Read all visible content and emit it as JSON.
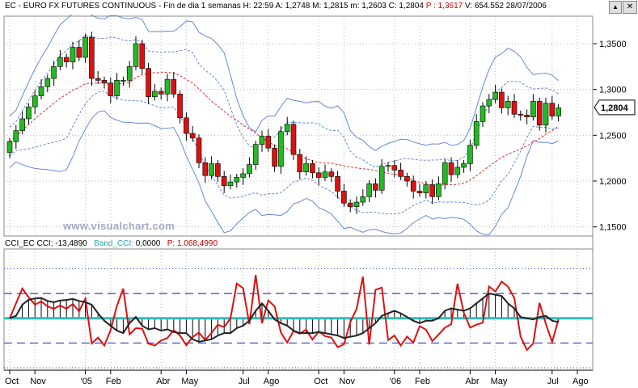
{
  "window": {
    "title_prefix": "EC - EURO FX FUTURES CONTINUOUS - Fin de dia 1 semanas H: 22:59 A: 1,2748 M: 1,2815 m: 1,2603 C: 1,2804",
    "title_p": "P : 1,3617",
    "title_suffix": "V: 654.552 28/07/2006",
    "close_glyph": "✕",
    "scroll_glyph": "▲"
  },
  "watermark": "www.visualchart.com",
  "colors": {
    "up": "#22bb22",
    "down": "#dd1111",
    "band": "#6688dd",
    "ma": "#dd3333",
    "cci": "#222222",
    "cci_signal": "#dd1111",
    "band_cci": "#33bbbb",
    "dash": "#3344bb"
  },
  "chart_data": [
    {
      "type": "candlestick",
      "title": "EC - EURO FX FUTURES CONTINUOUS",
      "ylim": [
        1.14,
        1.38
      ],
      "yticks": [
        "1,3500",
        "1,3000",
        "1,2500",
        "1,2000",
        "1,1500"
      ],
      "ytick_values": [
        1.35,
        1.3,
        1.25,
        1.2,
        1.15
      ],
      "last_close_label": "1,2804",
      "last_close": 1.2804,
      "close": [
        1.243,
        1.255,
        1.268,
        1.281,
        1.293,
        1.303,
        1.312,
        1.325,
        1.335,
        1.33,
        1.346,
        1.335,
        1.357,
        1.312,
        1.31,
        1.307,
        1.293,
        1.31,
        1.31,
        1.325,
        1.35,
        1.323,
        1.292,
        1.298,
        1.295,
        1.311,
        1.295,
        1.269,
        1.252,
        1.247,
        1.22,
        1.206,
        1.219,
        1.205,
        1.195,
        1.199,
        1.204,
        1.208,
        1.218,
        1.24,
        1.249,
        1.236,
        1.216,
        1.254,
        1.262,
        1.229,
        1.21,
        1.219,
        1.209,
        1.204,
        1.21,
        1.205,
        1.189,
        1.176,
        1.172,
        1.177,
        1.183,
        1.197,
        1.19,
        1.216,
        1.217,
        1.212,
        1.205,
        1.2,
        1.189,
        1.187,
        1.196,
        1.183,
        1.197,
        1.22,
        1.207,
        1.215,
        1.219,
        1.239,
        1.265,
        1.282,
        1.289,
        1.297,
        1.28,
        1.287,
        1.273,
        1.272,
        1.27,
        1.287,
        1.261,
        1.285,
        1.271,
        1.28
      ]
    },
    {
      "type": "line",
      "legend_label": "CCI_EC",
      "cci_label": "CCI:",
      "cci_value": "-13,4890",
      "band_label": "Band_CCI:",
      "band_value": "0,0000",
      "p_label": "P:",
      "p_value": "1.068,4990",
      "cci": [
        0,
        10,
        55,
        75,
        80,
        82,
        70,
        65,
        72,
        74,
        78,
        70,
        65,
        55,
        20,
        -10,
        -30,
        -50,
        -60,
        -20,
        5,
        -30,
        -45,
        -40,
        -50,
        -45,
        -55,
        -60,
        -60,
        -85,
        -95,
        -90,
        -85,
        -70,
        -60,
        -60,
        -40,
        -30,
        -10,
        30,
        60,
        30,
        -5,
        -20,
        -30,
        -50,
        -60,
        -60,
        -60,
        -55,
        -60,
        -65,
        -70,
        -80,
        -75,
        -70,
        -60,
        -40,
        -20,
        10,
        20,
        30,
        20,
        5,
        -10,
        -20,
        -10,
        -10,
        0,
        30,
        40,
        35,
        30,
        40,
        60,
        80,
        100,
        95,
        90,
        60,
        40,
        5,
        0,
        -5,
        5,
        10,
        -10,
        -15
      ],
      "cci_signal": [
        0,
        60,
        120,
        85,
        55,
        68,
        48,
        38,
        52,
        38,
        58,
        28,
        80,
        -102,
        -78,
        -110,
        -48,
        50,
        120,
        -65,
        -40,
        -42,
        -103,
        -110,
        -90,
        -80,
        -48,
        -70,
        -109,
        -76,
        -58,
        -88,
        -59,
        -26,
        -36,
        0,
        140,
        122,
        -24,
        175,
        -20,
        72,
        48,
        -58,
        -98,
        -52,
        -62,
        -46,
        -86,
        -54,
        -72,
        -78,
        -117,
        -105,
        -16,
        38,
        168,
        -106,
        115,
        124,
        -88,
        -70,
        -110,
        -74,
        -98,
        -32,
        -46,
        -92,
        -66,
        -38,
        -24,
        140,
        22,
        -38,
        -26,
        -18,
        128,
        108,
        148,
        128,
        82,
        -74,
        -128,
        -102,
        62,
        -22,
        -96,
        -5
      ],
      "dash_levels": [
        100,
        0,
        -100
      ],
      "dotted_levels": [
        200,
        -200
      ],
      "ylim": [
        -210,
        280
      ]
    }
  ],
  "x_axis": {
    "ticks": [
      {
        "label": "Oct",
        "i": 0
      },
      {
        "label": "Nov",
        "i": 4
      },
      {
        "label": "'05",
        "i": 12
      },
      {
        "label": "Feb",
        "i": 16
      },
      {
        "label": "Abr",
        "i": 24
      },
      {
        "label": "May",
        "i": 28
      },
      {
        "label": "Jul",
        "i": 37
      },
      {
        "label": "Ago",
        "i": 41
      },
      {
        "label": "Oct",
        "i": 49
      },
      {
        "label": "Nov",
        "i": 53
      },
      {
        "label": "'06",
        "i": 61
      },
      {
        "label": "Feb",
        "i": 65
      },
      {
        "label": "Abr",
        "i": 73
      },
      {
        "label": "May",
        "i": 77
      },
      {
        "label": "Jul",
        "i": 86
      },
      {
        "label": "Ago",
        "i": 90
      }
    ]
  }
}
